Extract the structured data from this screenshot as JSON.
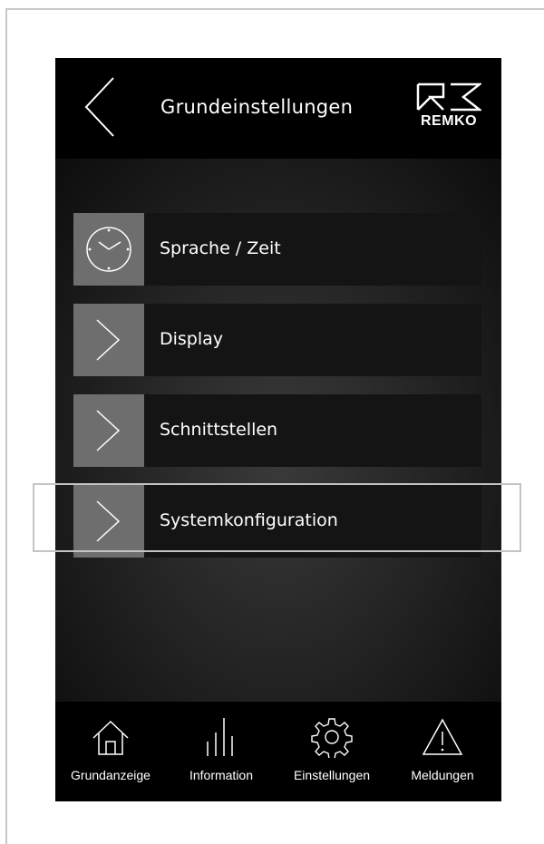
{
  "header": {
    "title": "Grundeinstellungen",
    "back_icon": "chevron-left-icon",
    "logo_text": "REMKO"
  },
  "menu": {
    "items": [
      {
        "label": "Sprache / Zeit",
        "icon": "clock-icon"
      },
      {
        "label": "Display",
        "icon": "chevron-right-icon"
      },
      {
        "label": "Schnittstellen",
        "icon": "chevron-right-icon"
      },
      {
        "label": "Systemkonfiguration",
        "icon": "chevron-right-icon",
        "highlighted": true
      }
    ]
  },
  "nav": {
    "items": [
      {
        "label": "Grundanzeige",
        "icon": "home-icon"
      },
      {
        "label": "Information",
        "icon": "bar-chart-icon"
      },
      {
        "label": "Einstellungen",
        "icon": "gear-icon"
      },
      {
        "label": "Meldungen",
        "icon": "warning-icon"
      }
    ]
  },
  "colors": {
    "header_bg": "#000000",
    "icon_box": "#6e6e6e",
    "menu_bar": "#141414",
    "highlight_border": "#c4c4c4"
  }
}
